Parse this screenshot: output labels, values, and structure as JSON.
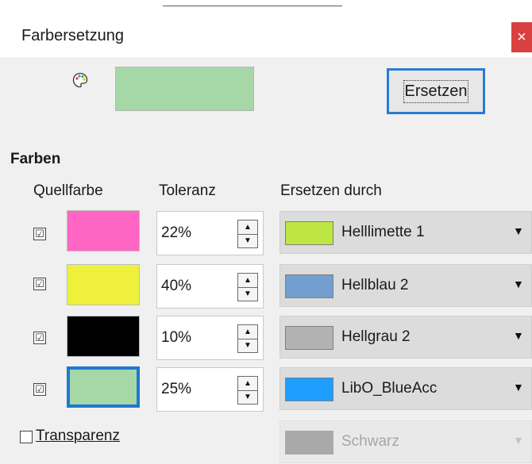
{
  "window": {
    "title": "Farbersetzung",
    "close_glyph": "×"
  },
  "preview": {
    "color": "#a6d7a6",
    "icon": "palette-icon"
  },
  "replace_button": {
    "label": "Ersetzen"
  },
  "section": {
    "title": "Farben"
  },
  "columns": {
    "source": "Quellfarbe",
    "tolerance": "Toleranz",
    "replace_with": "Ersetzen durch"
  },
  "rows": [
    {
      "checked": true,
      "check_glyph": "☑",
      "source_color": "#ff66c4",
      "tolerance": "22%",
      "replace_name": "Helllimette 1",
      "replace_color": "#bde645",
      "selected": false
    },
    {
      "checked": true,
      "check_glyph": "☑",
      "source_color": "#eef03c",
      "tolerance": "40%",
      "replace_name": "Hellblau 2",
      "replace_color": "#729fcf",
      "selected": false
    },
    {
      "checked": true,
      "check_glyph": "☑",
      "source_color": "#000000",
      "tolerance": "10%",
      "replace_name": "Hellgrau 2",
      "replace_color": "#b2b2b2",
      "selected": false
    },
    {
      "checked": true,
      "check_glyph": "☑",
      "source_color": "#a6d7a6",
      "tolerance": "25%",
      "replace_name": "LibO_BlueAcc",
      "replace_color": "#1e9fff",
      "selected": true
    }
  ],
  "transparency": {
    "label": "Transparenz",
    "checked": false,
    "replace_name": "Schwarz",
    "disabled": true
  },
  "icons": {
    "spin_up": "▲",
    "spin_down": "▼",
    "dropdown": "▼"
  }
}
